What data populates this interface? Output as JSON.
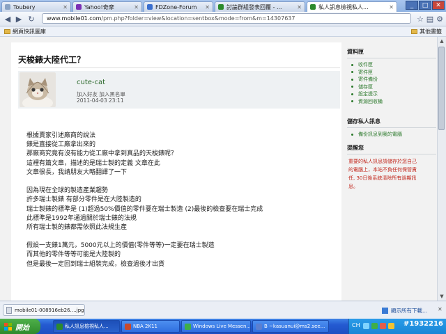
{
  "browser": {
    "tabs": [
      {
        "label": "Toubery",
        "favicon_color": "#8aa3c4"
      },
      {
        "label": "Yahoo!奇摩",
        "favicon_color": "#7b2fb5"
      },
      {
        "label": "FDZone-Forum",
        "favicon_color": "#3a6fcf"
      },
      {
        "label": "討論群組發表回覆 - ...",
        "favicon_color": "#2c8a2c"
      },
      {
        "label": "私人訊息檢視私人...",
        "favicon_color": "#2c8a2c"
      }
    ],
    "window_buttons": {
      "minimize": "_",
      "maximize": "□",
      "close": "✕"
    },
    "url": {
      "prefix": "www.mobile01.com",
      "path": "/pm.php?folder=view&location=sentbox&mode=from&m=14307637"
    },
    "bookmarks": {
      "left": "網頁快訊圖庫",
      "right": "其他書籤"
    }
  },
  "page": {
    "title": "天梭錶大陸代工？",
    "user": {
      "name": "cute-cat",
      "links": "加入好友  加入黑名單",
      "date": "2011-04-03 23:11"
    },
    "body_lines": [
      "根據賣家引述廠商的說法",
      "錶是直接從工廠拿出來的",
      "那廠商究竟有沒有能力從工廠中拿到真品的天梭錶呢？",
      "這裡有篇文章，描述的是瑞士製的定義 文章在此",
      "文章很長，我請朋友大略翻譯了一下",
      "",
      "因為現在全球的製造產業趨勢",
      "許多瑞士製錶 有部分零件是在大陸製造的",
      "瑞士製錶的標準是 (1)超過50%價值的零件要在瑞士製造 (2)最後的檢查要在瑞士完成",
      "此標準是1992年通過關於瑞士錶的法規",
      "所有瑞士製的錶都需依照此法規生產",
      "",
      "假設一支錶1萬元，5000元以上的價值(零件等等)一定要在瑞士製造",
      "而其他的零件等等可能是大陸製的",
      "但是最後一定回到瑞士組裝完成，檢查過後才出貨"
    ]
  },
  "sidebar": {
    "mailbox": {
      "heading": "資料匣",
      "items": [
        "收件匣",
        "寄件匣",
        "寄件備份",
        "儲存匣",
        "設定提示",
        "資源回收桶"
      ]
    },
    "save": {
      "heading": "儲存私人訊息",
      "items": [
        "備份訊息到我的電腦"
      ]
    },
    "notice": {
      "heading": "提醒您",
      "text_lines": [
        "重要的私人訊息請儲存於您自己",
        "的電腦上，本站不負任何保管責",
        "任, 30日後系統清除所有過期訊",
        "息。"
      ]
    }
  },
  "downloads": {
    "item": "mobile01-008916eb26….jpg",
    "show_all": "顯示所有下載…",
    "close": "✕"
  },
  "taskbar": {
    "start": "開始",
    "buttons": [
      {
        "label": "私人訊息檢視私人...",
        "color": "#2c8a2c"
      },
      {
        "label": "NBA 2K11",
        "color": "#c9492c"
      },
      {
        "label": "Windows Live Messen...",
        "color": "#3fae49"
      },
      {
        "label": "B ~kasuanui@ms2.see...",
        "color": "#5b7fd0"
      }
    ],
    "lang": "CH",
    "overlay_id": "#1932216"
  }
}
